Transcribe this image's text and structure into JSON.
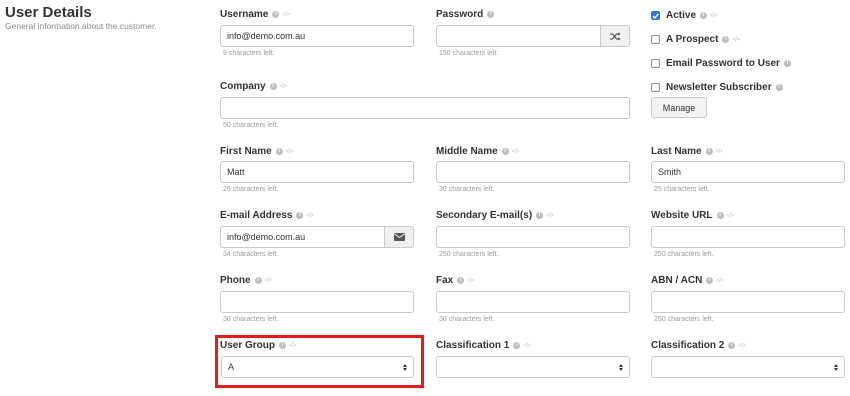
{
  "section": {
    "title": "User Details",
    "subtitle": "General information about the customer."
  },
  "username": {
    "label": "Username",
    "value": "info@demo.com.au",
    "help": "9 characters left."
  },
  "password": {
    "label": "Password",
    "value": "",
    "help": "150 characters left."
  },
  "company": {
    "label": "Company",
    "value": "",
    "help": "50 characters left."
  },
  "first_name": {
    "label": "First Name",
    "value": "Matt",
    "help": "26 characters left."
  },
  "middle_name": {
    "label": "Middle Name",
    "value": "",
    "help": "30 characters left."
  },
  "last_name": {
    "label": "Last Name",
    "value": "Smith",
    "help": "25 characters left."
  },
  "email": {
    "label": "E-mail Address",
    "value": "info@demo.com.au",
    "help": "34 characters left."
  },
  "secondary_email": {
    "label": "Secondary E-mail(s)",
    "value": "",
    "help": "250 characters left."
  },
  "website": {
    "label": "Website URL",
    "value": "",
    "help": "250 characters left."
  },
  "phone": {
    "label": "Phone",
    "value": "",
    "help": "30 characters left."
  },
  "fax": {
    "label": "Fax",
    "value": "",
    "help": "30 characters left."
  },
  "abn": {
    "label": "ABN / ACN",
    "value": "",
    "help": "250 characters left."
  },
  "user_group": {
    "label": "User Group",
    "value": "A"
  },
  "classification1": {
    "label": "Classification 1",
    "value": ""
  },
  "classification2": {
    "label": "Classification 2",
    "value": ""
  },
  "options": {
    "active": {
      "label": "Active",
      "checked": true
    },
    "prospect": {
      "label": "A Prospect",
      "checked": false
    },
    "email_password": {
      "label": "Email Password to User",
      "checked": false
    },
    "newsletter": {
      "label": "Newsletter Subscriber",
      "checked": false
    },
    "manage_label": "Manage"
  },
  "colors": {
    "accent": "#2a7bd6",
    "highlight": "#e31b1b"
  },
  "icons": {
    "info": "info-circle-icon",
    "code": "code-icon",
    "shuffle": "shuffle-icon",
    "envelope": "envelope-icon",
    "check": "check-icon",
    "select_caret": "sort-caret-icon"
  }
}
